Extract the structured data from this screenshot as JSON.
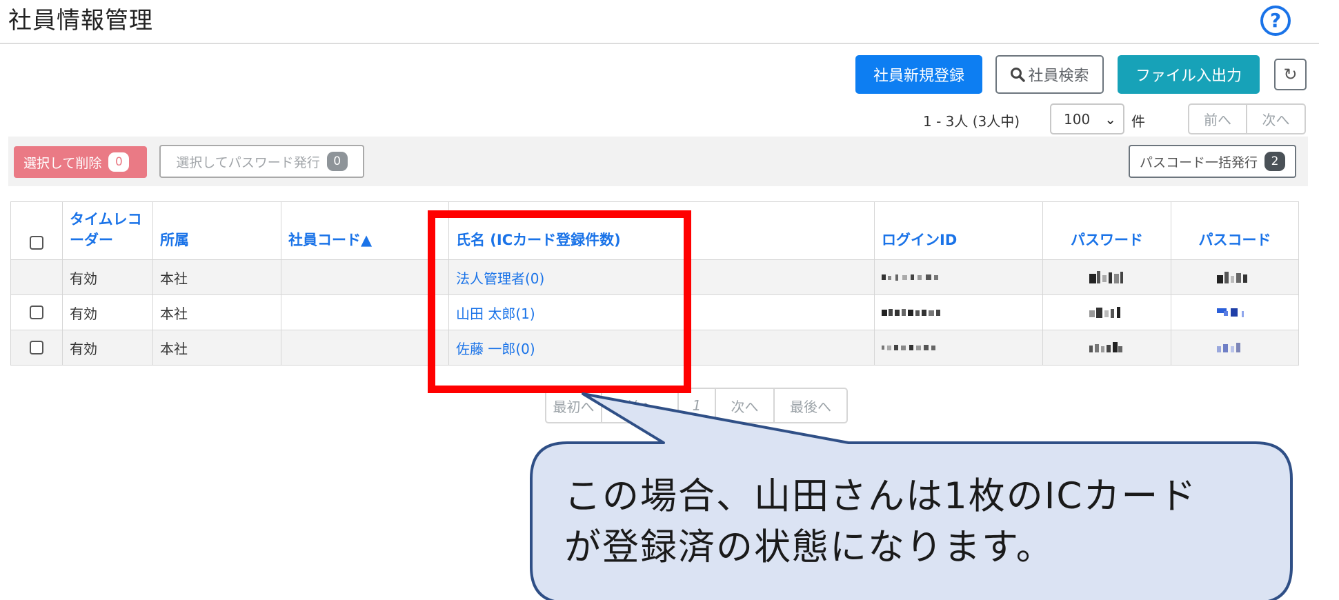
{
  "header": {
    "title": "社員情報管理",
    "help_icon": "question-circle-icon",
    "help_symbol": "?",
    "accent": "#1a73e8"
  },
  "toolbar": {
    "register_label": "社員新規登録",
    "search_icon": "search-icon",
    "search_label": "社員検索",
    "file_label": "ファイル入出力",
    "refresh_icon": "refresh-icon",
    "refresh_symbol": "↻",
    "colors": {
      "primary": "#0d7ef2",
      "info": "#17a2b8",
      "danger": "#ea7a85"
    }
  },
  "pagination_top": {
    "count_text": "1 - 3人 (3人中)",
    "per_page": "100",
    "unit": "件",
    "prev_label": "前へ",
    "next_label": "次へ"
  },
  "actions": {
    "delete_label": "選択して削除",
    "delete_count": "0",
    "password_label": "選択してパスワード発行",
    "password_count": "0",
    "passcode_label": "パスコード一括発行",
    "passcode_count": "2"
  },
  "table": {
    "headers": {
      "timecard": "タイムレコーダー",
      "department": "所属",
      "code": "社員コード▲",
      "name": "氏名 (ICカード登録件数)",
      "login": "ログインID",
      "password": "パスワード",
      "passcode": "パスコード"
    },
    "rows": [
      {
        "status": "有効",
        "department": "本社",
        "code": "",
        "name": "法人管理者(0)"
      },
      {
        "status": "有効",
        "department": "本社",
        "code": "",
        "name": "山田 太郎(1)"
      },
      {
        "status": "有効",
        "department": "本社",
        "code": "",
        "name": "佐藤 一郎(0)"
      }
    ]
  },
  "pagination_bottom": {
    "first_label": "最初へ",
    "prev_label": "前へ",
    "current": "1",
    "next_label": "次へ",
    "last_label": "最後へ"
  },
  "annotation": {
    "highlight_color": "#ff0000",
    "callout_line1": "この場合、山田さんは1枚のICカード",
    "callout_line2": "が登録済の状態になります。",
    "callout_fill": "#dbe3f3",
    "callout_border": "#2f4f86"
  }
}
